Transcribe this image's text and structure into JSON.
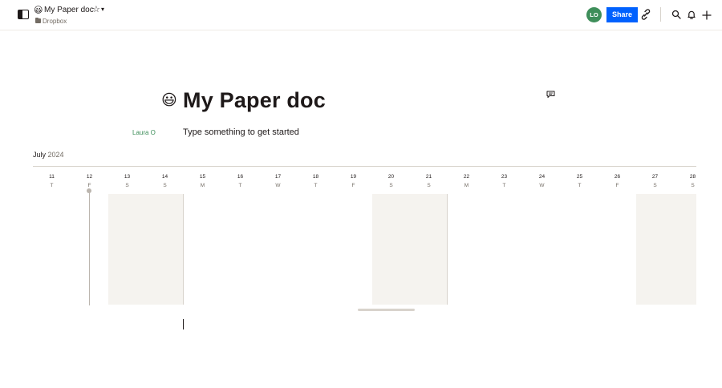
{
  "header": {
    "doc_emoji": "😃",
    "doc_title": "My Paper doc",
    "breadcrumb": "Dropbox",
    "avatar_initials": "LO",
    "share_label": "Share"
  },
  "icons": {
    "sidebar_toggle": "sidebar-toggle-icon",
    "star": "star-icon",
    "chevron": "chevron-down-icon",
    "folder": "folder-icon",
    "link": "link-icon",
    "search": "search-icon",
    "bell": "bell-icon",
    "plus": "plus-icon",
    "comment": "comment-icon"
  },
  "document": {
    "emoji": "😃",
    "title": "My Paper doc",
    "author": "Laura O",
    "placeholder": "Type something to get started"
  },
  "timeline": {
    "month": "July",
    "year": "2024",
    "days": [
      {
        "num": "11",
        "dow": "T",
        "shaded": false
      },
      {
        "num": "12",
        "dow": "F",
        "shaded": false,
        "today": true
      },
      {
        "num": "13",
        "dow": "S",
        "shaded": true
      },
      {
        "num": "14",
        "dow": "S",
        "shaded": true
      },
      {
        "num": "15",
        "dow": "M",
        "shaded": false
      },
      {
        "num": "16",
        "dow": "T",
        "shaded": false
      },
      {
        "num": "17",
        "dow": "W",
        "shaded": false
      },
      {
        "num": "18",
        "dow": "T",
        "shaded": false
      },
      {
        "num": "19",
        "dow": "F",
        "shaded": false
      },
      {
        "num": "20",
        "dow": "S",
        "shaded": true
      },
      {
        "num": "21",
        "dow": "S",
        "shaded": true
      },
      {
        "num": "22",
        "dow": "M",
        "shaded": false
      },
      {
        "num": "23",
        "dow": "T",
        "shaded": false
      },
      {
        "num": "24",
        "dow": "W",
        "shaded": false
      },
      {
        "num": "25",
        "dow": "T",
        "shaded": false
      },
      {
        "num": "26",
        "dow": "F",
        "shaded": false
      },
      {
        "num": "27",
        "dow": "S",
        "shaded": true
      },
      {
        "num": "28",
        "dow": "S",
        "shaded": true
      }
    ]
  },
  "colors": {
    "accent": "#0061fe",
    "avatar": "#3e8e5a",
    "author": "#3e8e5a",
    "weekend_shade": "#f5f3ef"
  }
}
